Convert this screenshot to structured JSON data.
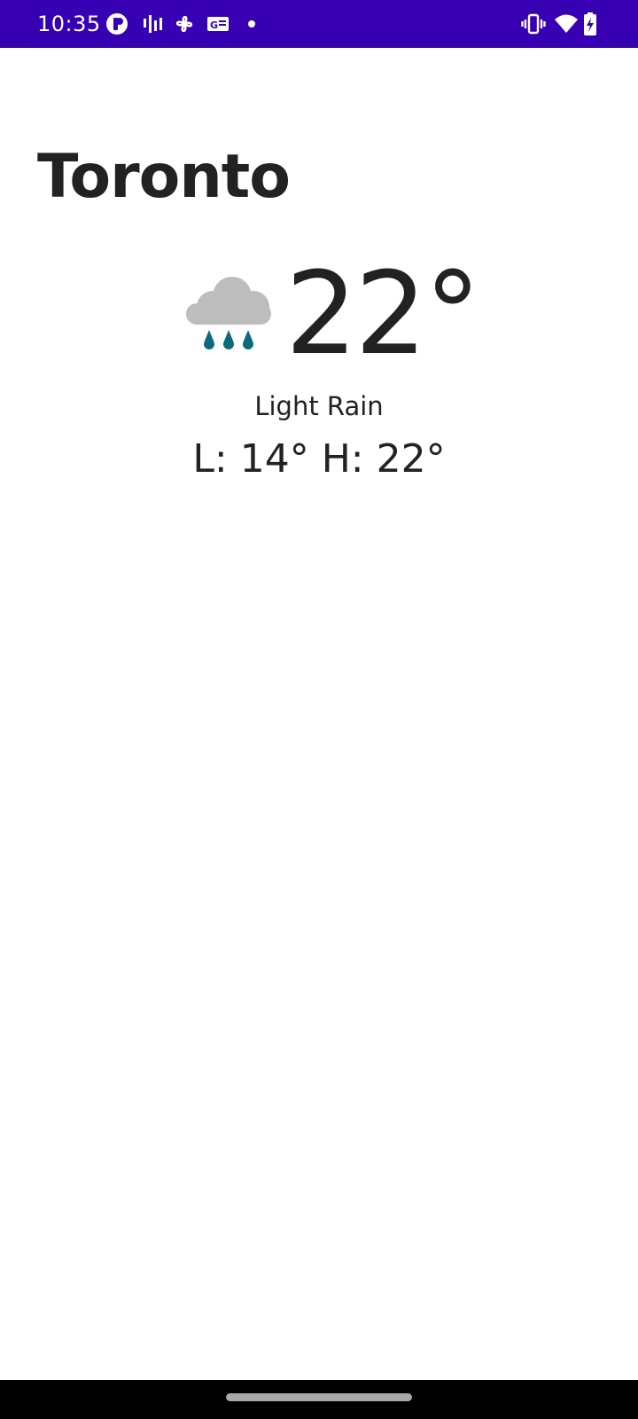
{
  "status_bar": {
    "time": "10:35",
    "background": "#3700b3",
    "left_icons": [
      "app-notification-icon",
      "signal-bars-icon",
      "pinwheel-icon",
      "translate-icon",
      "dot-icon"
    ],
    "right_icons": [
      "vibrate-icon",
      "wifi-icon",
      "battery-charging-icon"
    ]
  },
  "location": {
    "city": "Toronto"
  },
  "current": {
    "icon": "light-rain-icon",
    "temperature": "22°",
    "condition": "Light Rain",
    "low_label": "L:",
    "low_value": "14°",
    "high_label": "H:",
    "high_value": "22°"
  },
  "colors": {
    "text": "#222222",
    "cloud": "#bdbdbd",
    "raindrop": "#0b6b7d"
  }
}
